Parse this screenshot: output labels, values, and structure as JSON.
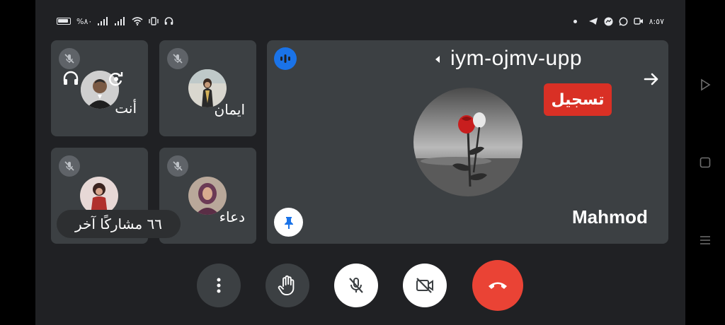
{
  "status_bar": {
    "battery_percent": "%٨٠",
    "time": "٨:٥٧"
  },
  "meeting": {
    "code": "iym-ojmv-upp",
    "recording_label": "تسجيل",
    "others_label": "٦٦ مشاركًا آخر"
  },
  "participants": [
    {
      "name": "أنت",
      "muted": true
    },
    {
      "name": "ايمان",
      "muted": true
    },
    {
      "name": "",
      "muted": true
    },
    {
      "name": "دعاء",
      "muted": true
    }
  ],
  "main_speaker": {
    "name": "Mahmod"
  },
  "colors": {
    "app_bg": "#202124",
    "tile_bg": "#3c4043",
    "record_red": "#d93025",
    "end_call_red": "#ea4335",
    "speaking_blue": "#1a73e8"
  },
  "icons": [
    "menu-dots-icon",
    "raise-hand-icon",
    "mic-off-icon",
    "camera-off-icon",
    "end-call-icon",
    "pin-icon",
    "audio-level-icon",
    "headphones-icon",
    "switch-camera-icon",
    "arrow-right-icon"
  ]
}
